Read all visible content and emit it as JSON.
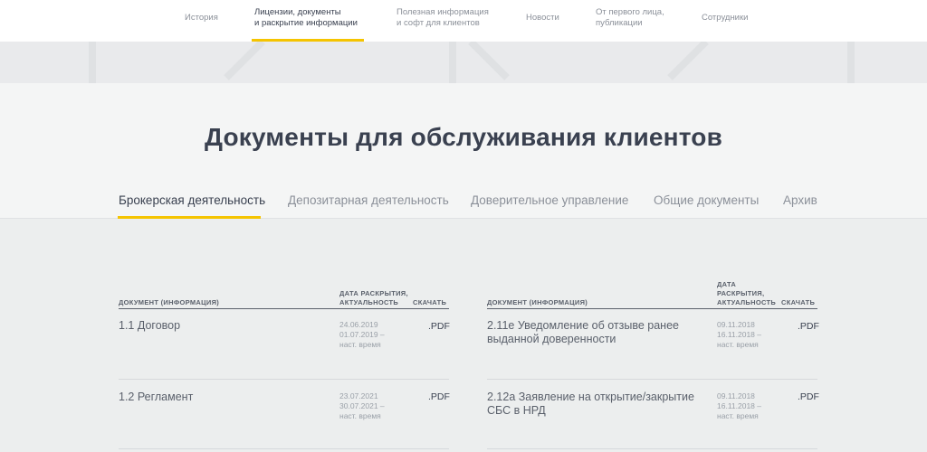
{
  "nav": {
    "items": [
      {
        "label_1": "История",
        "label_2": ""
      },
      {
        "label_1": "Лицензии, документы",
        "label_2": "и раскрытие информации"
      },
      {
        "label_1": "Полезная информация",
        "label_2": "и софт для клиентов"
      },
      {
        "label_1": "Новости",
        "label_2": ""
      },
      {
        "label_1": "От первого лица,",
        "label_2": "публикации"
      },
      {
        "label_1": "Сотрудники",
        "label_2": ""
      }
    ],
    "active_index": 1
  },
  "page": {
    "title": "Документы для обслуживания клиентов"
  },
  "tabs": {
    "items": [
      "Брокерская деятельность",
      "Депозитарная деятельность",
      "Доверительное управление",
      "Общие документы",
      "Архив"
    ],
    "active_index": 0
  },
  "tables": {
    "left": {
      "col_doc": "ДОКУМЕНТ (ИНФОРМАЦИЯ)",
      "col_date_1": "ДАТА РАСКРЫТИЯ,",
      "col_date_2": "АКТУАЛЬНОСТЬ",
      "col_download": "СКАЧАТЬ",
      "rows": [
        {
          "name_1": "1.1 Договор",
          "name_2": "",
          "date_1": "24.06.2019",
          "date_2": "01.07.2019  –",
          "date_3": "наст. время",
          "file": ".PDF"
        },
        {
          "name_1": "1.2 Регламент",
          "name_2": "",
          "date_1": "23.07.2021",
          "date_2": "30.07.2021  –",
          "date_3": "наст. время",
          "file": ".PDF"
        }
      ]
    },
    "right": {
      "col_doc": "ДОКУМЕНТ (ИНФОРМАЦИЯ)",
      "col_date_1": "ДАТА",
      "col_date_2": "РАСКРЫТИЯ,",
      "col_date_3": "АКТУАЛЬНОСТЬ",
      "col_download": "СКАЧАТЬ",
      "rows": [
        {
          "name_1": "2.11е Уведомление об отзыве ранее",
          "name_2": "выданной доверенности",
          "date_1": "09.11.2018",
          "date_2": "16.11.2018  –",
          "date_3": "наст. время",
          "file": ".PDF"
        },
        {
          "name_1": "2.12а Заявление на открытие/закрытие",
          "name_2": "СБС в НРД",
          "date_1": "09.11.2018",
          "date_2": "16.11.2018  –",
          "date_3": "наст. время",
          "file": ".PDF"
        }
      ]
    }
  },
  "colors": {
    "accent": "#f5c400",
    "text": "#3a4150",
    "muted": "#8b9099"
  }
}
